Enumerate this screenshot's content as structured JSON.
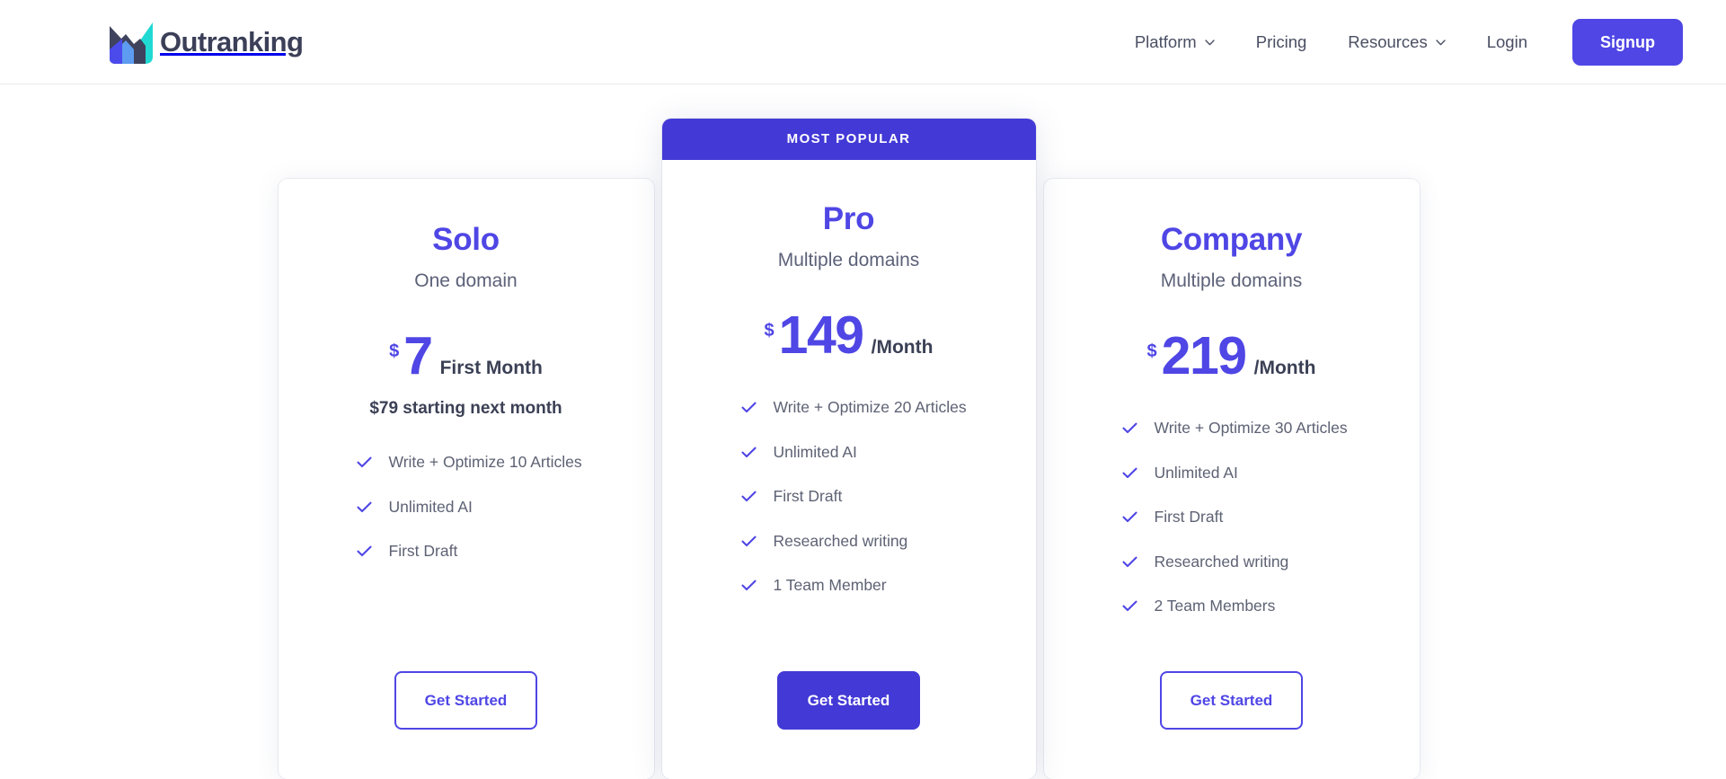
{
  "brand": {
    "name": "Outranking",
    "logo_icon": "mountain-chart-logo",
    "logo_colors": {
      "dark": "#3f435e",
      "cyan": "#1fd9d2",
      "blue": "#4b6ef5",
      "indigo": "#4f46e5"
    }
  },
  "nav": {
    "items": [
      {
        "label": "Platform",
        "has_dropdown": true,
        "icon": "chevron-down-icon"
      },
      {
        "label": "Pricing",
        "has_dropdown": false,
        "icon": ""
      },
      {
        "label": "Resources",
        "has_dropdown": true,
        "icon": "chevron-down-icon"
      },
      {
        "label": "Login",
        "has_dropdown": false,
        "icon": ""
      }
    ],
    "signup_label": "Signup"
  },
  "colors": {
    "accent": "#4f46e5",
    "accent_solid": "#4339d6",
    "text_dark": "#3b4055",
    "text_muted": "#5d6274",
    "card_bg": "#ffffff",
    "page_bg": "#ffffff"
  },
  "pricing": {
    "badge_label": "MOST  POPULAR",
    "plans": [
      {
        "id": "solo",
        "name": "Solo",
        "subtitle": "One domain",
        "currency": "$",
        "amount": "7",
        "period": "First Month",
        "note": "$79 starting next month",
        "featured": false,
        "cta_label": "Get Started",
        "cta_style": "outline",
        "features": [
          "Write + Optimize 10 Articles",
          "Unlimited AI",
          "First Draft"
        ]
      },
      {
        "id": "pro",
        "name": "Pro",
        "subtitle": "Multiple domains",
        "currency": "$",
        "amount": "149",
        "period": "/Month",
        "note": "",
        "featured": true,
        "cta_label": "Get Started",
        "cta_style": "solid",
        "features": [
          "Write + Optimize 20 Articles",
          "Unlimited AI",
          "First Draft",
          "Researched writing",
          "1 Team Member"
        ]
      },
      {
        "id": "company",
        "name": "Company",
        "subtitle": "Multiple domains",
        "currency": "$",
        "amount": "219",
        "period": "/Month",
        "note": "",
        "featured": false,
        "cta_label": "Get Started",
        "cta_style": "outline",
        "features": [
          "Write + Optimize 30 Articles",
          "Unlimited AI",
          "First Draft",
          "Researched writing",
          "2 Team Members"
        ]
      }
    ]
  }
}
